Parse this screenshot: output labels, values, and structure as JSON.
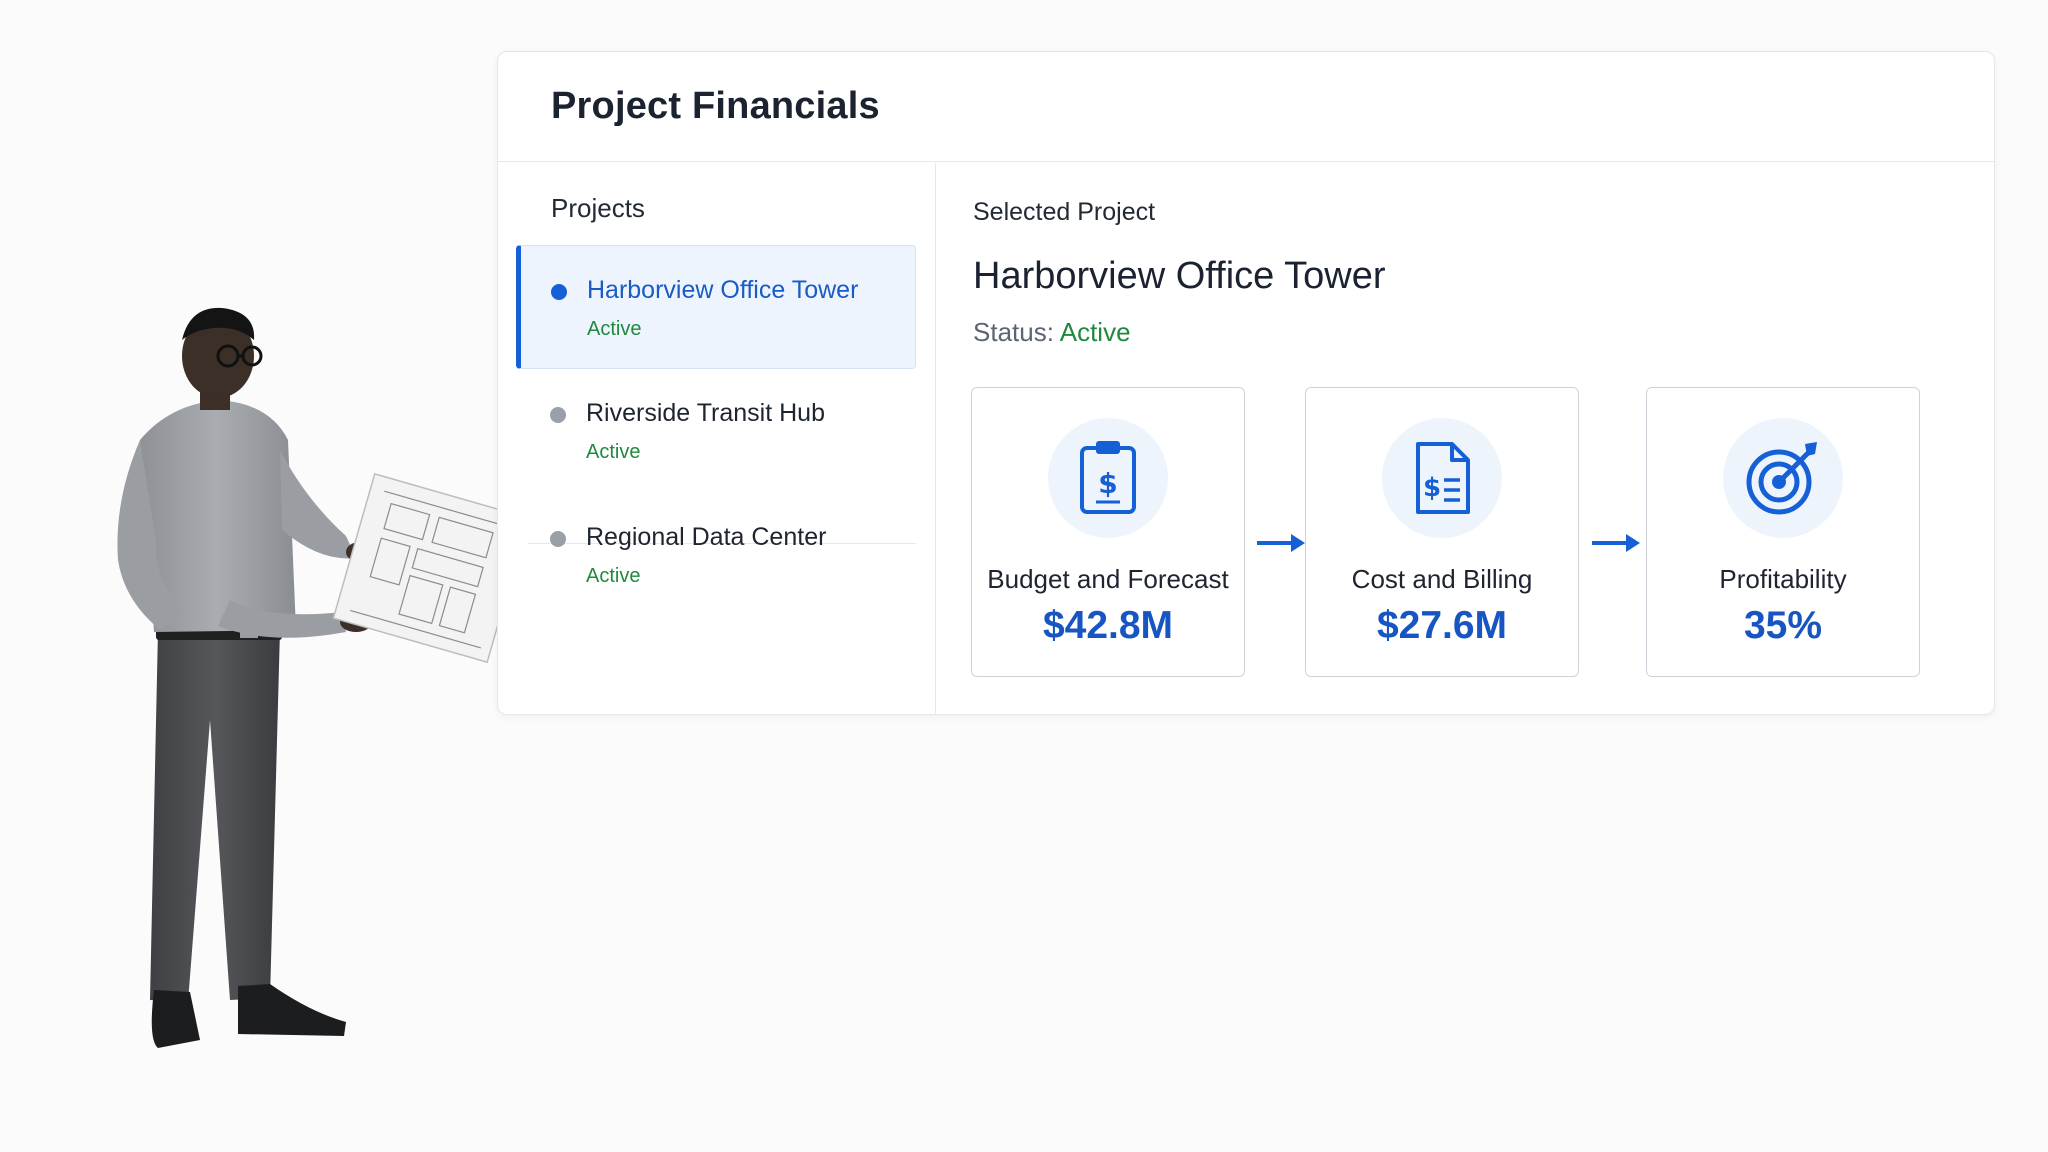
{
  "card": {
    "title": "Project Financials"
  },
  "projects": {
    "label": "Projects",
    "items": [
      {
        "name": "Harborview Office Tower",
        "status": "Active",
        "selected": true
      },
      {
        "name": "Riverside Transit Hub",
        "status": "Active",
        "selected": false
      },
      {
        "name": "Regional Data Center",
        "status": "Active",
        "selected": false
      }
    ]
  },
  "selected": {
    "label": "Selected Project",
    "name": "Harborview Office Tower",
    "status_label": "Status:",
    "status_value": "Active"
  },
  "metrics": [
    {
      "label": "Budget and Forecast",
      "value": "$42.8M",
      "icon": "clipboard-dollar-icon"
    },
    {
      "label": "Cost and Billing",
      "value": "$27.6M",
      "icon": "invoice-dollar-icon"
    },
    {
      "label": "Profitability",
      "value": "35%",
      "icon": "target-icon"
    }
  ],
  "colors": {
    "accent": "#1560d6",
    "value": "#1756c2",
    "active_status": "#1f8a3e",
    "selected_bg": "#eef4fd",
    "icon_bg": "#eef4fc"
  }
}
